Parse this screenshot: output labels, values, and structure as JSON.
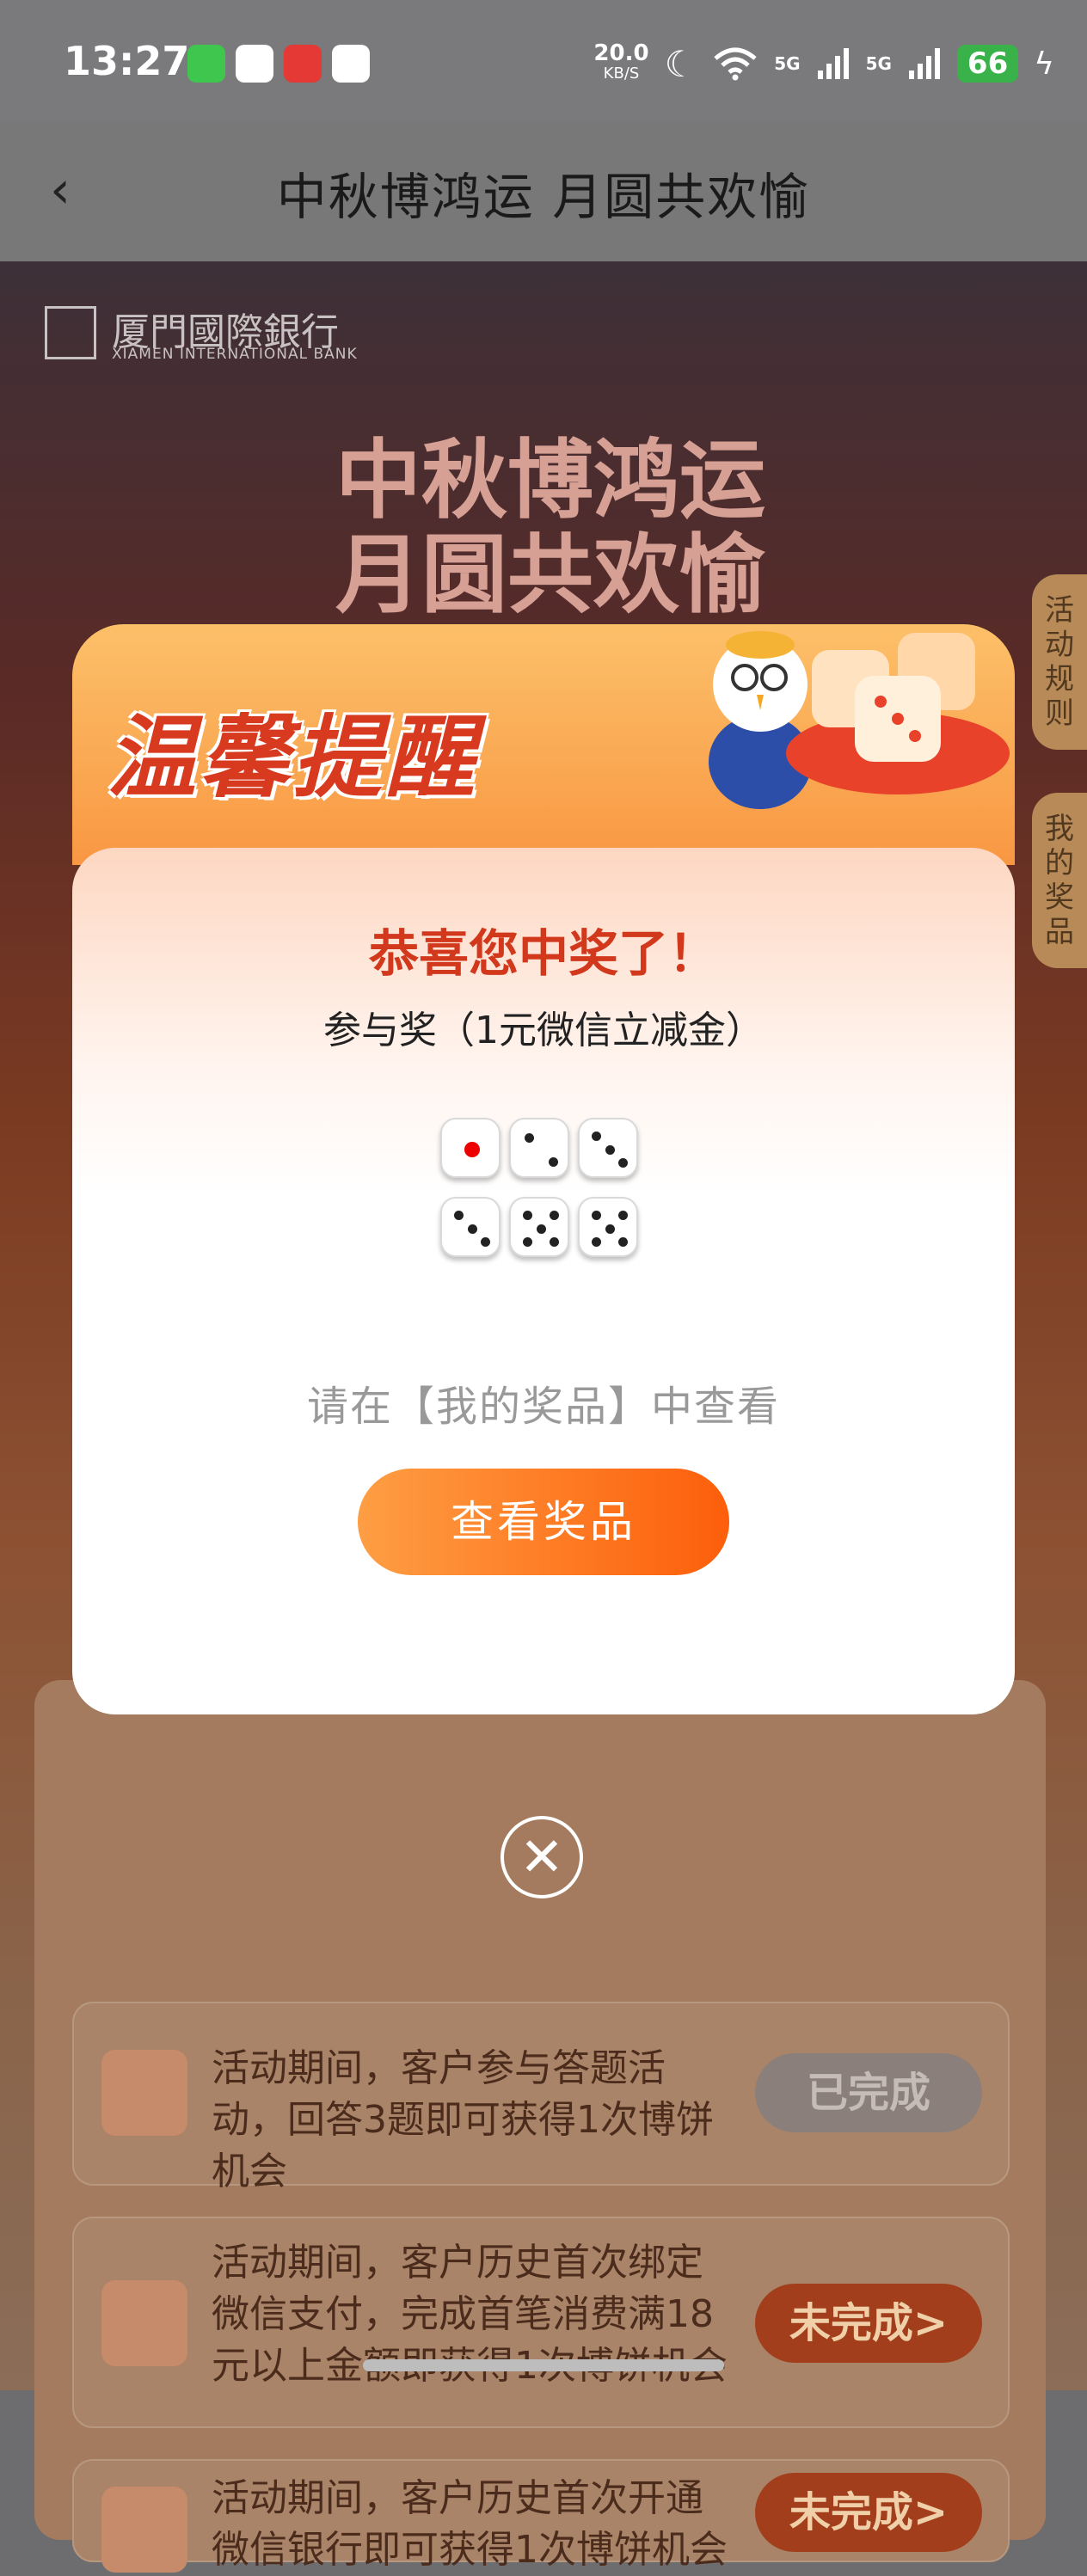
{
  "status_bar": {
    "time": "13:27",
    "net_speed": "20.0",
    "net_speed_unit": "KB/S",
    "signal_label_1": "5G",
    "signal_label_2": "5G",
    "battery": "66"
  },
  "header": {
    "back_icon": "‹",
    "title": "中秋博鸿运 月圆共欢愉"
  },
  "background": {
    "bank_name_cn": "厦門國際銀行",
    "bank_name_en": "XIAMEN INTERNATIONAL BANK",
    "banner_title_line1": "中秋博鸿运",
    "banner_title_line2": "月圆共欢愉",
    "side_tabs": [
      "活动规则",
      "我的奖品"
    ],
    "tasks": [
      {
        "text": "活动期间，客户参与答题活动，回答3题即可获得1次博饼机会",
        "button": "已完成"
      },
      {
        "text": "活动期间，客户历史首次绑定微信支付，完成首笔消费满18元以上金额即获得1次博饼机会",
        "button": "未完成>"
      },
      {
        "text": "活动期间，客户历史首次开通微信银行即可获得1次博饼机会",
        "button": "未完成>"
      }
    ]
  },
  "modal": {
    "header_title": "温馨提醒",
    "congrats": "恭喜您中奖了！",
    "prize": "参与奖（1元微信立减金）",
    "dice_values": [
      1,
      2,
      3,
      3,
      5,
      5
    ],
    "hint": "请在【我的奖品】中查看",
    "view_button": "查看奖品",
    "close_icon": "✕"
  },
  "colors": {
    "accent_orange": "#fd5e0a",
    "congrats_red": "#d2381b",
    "done_button": "#8a7f7a",
    "todo_button": "#a23e1b"
  }
}
